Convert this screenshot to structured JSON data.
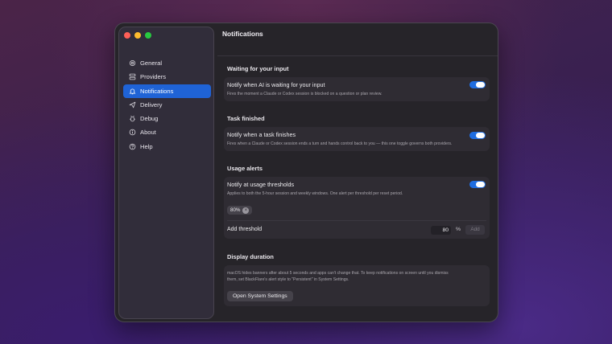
{
  "colors": {
    "accent": "#1f63d6",
    "toggle_on": "#1f6de0"
  },
  "sidebar": {
    "items": [
      {
        "label": "General",
        "icon": "gear-icon",
        "active": false
      },
      {
        "label": "Providers",
        "icon": "providers-icon",
        "active": false
      },
      {
        "label": "Notifications",
        "icon": "bell-icon",
        "active": true
      },
      {
        "label": "Delivery",
        "icon": "paper-plane-icon",
        "active": false
      },
      {
        "label": "Debug",
        "icon": "bug-icon",
        "active": false
      },
      {
        "label": "About",
        "icon": "info-icon",
        "active": false
      },
      {
        "label": "Help",
        "icon": "help-icon",
        "active": false
      }
    ]
  },
  "main": {
    "title": "Notifications",
    "waiting": {
      "heading": "Waiting for your input",
      "row_title": "Notify when AI is waiting for your input",
      "row_desc": "Fires the moment a Claude or Codex session is blocked on a question or plan review.",
      "enabled": true
    },
    "task": {
      "heading": "Task finished",
      "row_title": "Notify when a task finishes",
      "row_desc": "Fires when a Claude or Codex session ends a turn and hands control back to you — this one toggle governs both providers.",
      "enabled": true
    },
    "usage": {
      "heading": "Usage alerts",
      "row_title": "Notify at usage thresholds",
      "row_desc": "Applies to both the 5-hour session and weekly windows. One alert per threshold per reset period.",
      "enabled": true,
      "chip_label": "80%",
      "chip_remove": "×",
      "add_label": "Add threshold",
      "input_value": "80",
      "unit": "%",
      "add_button": "Add"
    },
    "display": {
      "heading": "Display duration",
      "desc_line1": "macOS hides banners after about 5 seconds and apps can't change that. To keep notifications on screen until you dismiss",
      "desc_line2": "them, set BlackFlare's alert style to \"Persistent\" in System Settings.",
      "button": "Open System Settings"
    }
  }
}
